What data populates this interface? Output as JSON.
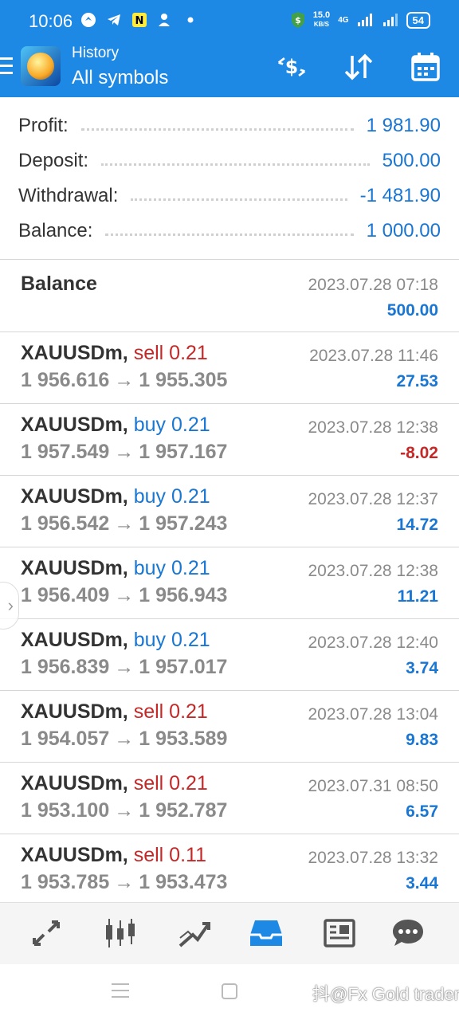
{
  "status_bar": {
    "time": "10:06",
    "speed_value": "15.0",
    "speed_unit": "KB/S",
    "network": "4G",
    "battery": "54"
  },
  "app_bar": {
    "title_small": "History",
    "title_big": "All symbols",
    "icons": [
      "currency-exchange-icon",
      "sort-icon",
      "calendar-icon"
    ]
  },
  "summary": {
    "profit_label": "Profit:",
    "profit_value": "1 981.90",
    "deposit_label": "Deposit:",
    "deposit_value": "500.00",
    "withdrawal_label": "Withdrawal:",
    "withdrawal_value": "-1 481.90",
    "balance_label": "Balance:",
    "balance_value": "1 000.00"
  },
  "balance_entry": {
    "label": "Balance",
    "datetime": "2023.07.28 07:18",
    "amount": "500.00"
  },
  "deals": [
    {
      "symbol": "XAUUSDm,",
      "side": "sell",
      "volume": "0.21",
      "open": "1 956.616",
      "close": "1 955.305",
      "datetime": "2023.07.28 11:46",
      "profit": "27.53"
    },
    {
      "symbol": "XAUUSDm,",
      "side": "buy",
      "volume": "0.21",
      "open": "1 957.549",
      "close": "1 957.167",
      "datetime": "2023.07.28 12:38",
      "profit": "-8.02"
    },
    {
      "symbol": "XAUUSDm,",
      "side": "buy",
      "volume": "0.21",
      "open": "1 956.542",
      "close": "1 957.243",
      "datetime": "2023.07.28 12:37",
      "profit": "14.72"
    },
    {
      "symbol": "XAUUSDm,",
      "side": "buy",
      "volume": "0.21",
      "open": "1 956.409",
      "close": "1 956.943",
      "datetime": "2023.07.28 12:38",
      "profit": "11.21"
    },
    {
      "symbol": "XAUUSDm,",
      "side": "buy",
      "volume": "0.21",
      "open": "1 956.839",
      "close": "1 957.017",
      "datetime": "2023.07.28 12:40",
      "profit": "3.74"
    },
    {
      "symbol": "XAUUSDm,",
      "side": "sell",
      "volume": "0.21",
      "open": "1 954.057",
      "close": "1 953.589",
      "datetime": "2023.07.28 13:04",
      "profit": "9.83"
    },
    {
      "symbol": "XAUUSDm,",
      "side": "sell",
      "volume": "0.21",
      "open": "1 953.100",
      "close": "1 952.787",
      "datetime": "2023.07.31 08:50",
      "profit": "6.57"
    },
    {
      "symbol": "XAUUSDm,",
      "side": "sell",
      "volume": "0.11",
      "open": "1 953.785",
      "close": "1 953.473",
      "datetime": "2023.07.28 13:32",
      "profit": "3.44"
    }
  ],
  "arrow_glyph": "→",
  "bottom_nav": [
    "quotes-icon",
    "chart-icon",
    "trade-icon",
    "history-icon",
    "news-icon",
    "messages-icon"
  ],
  "active_nav": "history-icon",
  "watermark": "抖@Fx Gold trader",
  "colors": {
    "header": "#1e88e5",
    "positive": "#1976d2",
    "negative": "#c62828"
  }
}
